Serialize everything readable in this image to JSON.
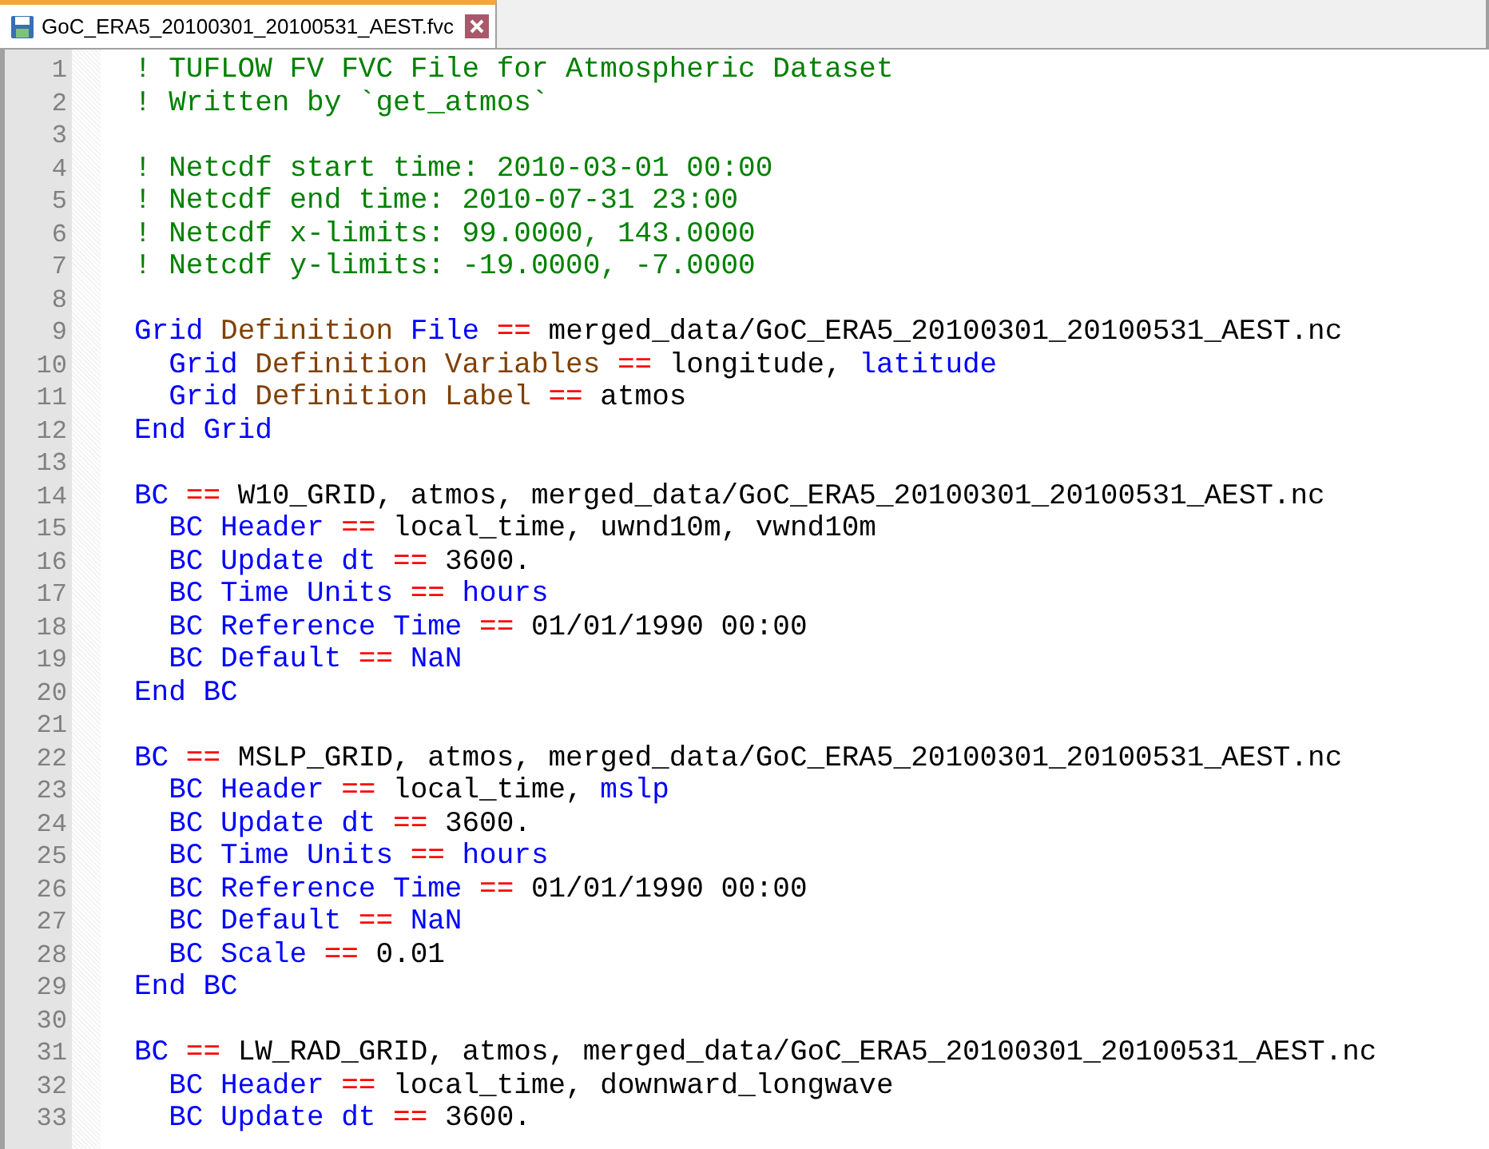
{
  "tab": {
    "title": "GoC_ERA5_20100301_20100531_AEST.fvc",
    "selected": true
  },
  "lines": [
    {
      "number": "1",
      "segments": [
        {
          "kind": "comment",
          "text": "! TUFLOW FV FVC File for Atmospheric Dataset"
        }
      ]
    },
    {
      "number": "2",
      "segments": [
        {
          "kind": "comment",
          "text": "! Written by `get_atmos`"
        }
      ]
    },
    {
      "number": "3"
    },
    {
      "number": "4",
      "segments": [
        {
          "kind": "comment",
          "text": "! Netcdf start time: 2010-03-01 00:00"
        }
      ]
    },
    {
      "number": "5",
      "segments": [
        {
          "kind": "comment",
          "text": "! Netcdf end time: 2010-07-31 23:00"
        }
      ]
    },
    {
      "number": "6",
      "segments": [
        {
          "kind": "comment",
          "text": "! Netcdf x-limits: 99.0000, 143.0000"
        }
      ]
    },
    {
      "number": "7",
      "segments": [
        {
          "kind": "comment",
          "text": "! Netcdf y-limits: -19.0000, -7.0000"
        }
      ]
    },
    {
      "number": "8"
    },
    {
      "number": "9",
      "segments": [
        {
          "kind": "keyword",
          "text": "Grid"
        },
        {
          "kind": "name",
          "text": " Definition"
        },
        {
          "kind": "keyword",
          "text": " File"
        },
        {
          "kind": "operator",
          "text": " =="
        },
        {
          "kind": "value",
          "text": " merged_data/GoC_ERA5_20100301_20100531_AEST.nc"
        }
      ]
    },
    {
      "number": "10",
      "segments": [
        {
          "kind": "keyword",
          "text": "  Grid"
        },
        {
          "kind": "name",
          "text": " Definition Variables"
        },
        {
          "kind": "operator",
          "text": " =="
        },
        {
          "kind": "value",
          "text": " longitude, "
        },
        {
          "kind": "keyword",
          "text": "latitude"
        }
      ]
    },
    {
      "number": "11",
      "segments": [
        {
          "kind": "keyword",
          "text": "  Grid"
        },
        {
          "kind": "name",
          "text": " Definition Label"
        },
        {
          "kind": "operator",
          "text": " =="
        },
        {
          "kind": "value",
          "text": " atmos"
        }
      ]
    },
    {
      "number": "12",
      "segments": [
        {
          "kind": "keyword",
          "text": "End Grid"
        }
      ]
    },
    {
      "number": "13"
    },
    {
      "number": "14",
      "segments": [
        {
          "kind": "keyword",
          "text": "BC"
        },
        {
          "kind": "operator",
          "text": " =="
        },
        {
          "kind": "value",
          "text": " W10_GRID, atmos, merged_data/GoC_ERA5_20100301_20100531_AEST.nc"
        }
      ]
    },
    {
      "number": "15",
      "segments": [
        {
          "kind": "keyword",
          "text": "  BC Header"
        },
        {
          "kind": "operator",
          "text": " =="
        },
        {
          "kind": "value",
          "text": " local_time, uwnd10m, vwnd10m"
        }
      ]
    },
    {
      "number": "16",
      "segments": [
        {
          "kind": "keyword",
          "text": "  BC Update dt"
        },
        {
          "kind": "operator",
          "text": " =="
        },
        {
          "kind": "value",
          "text": " 3600."
        }
      ]
    },
    {
      "number": "17",
      "segments": [
        {
          "kind": "keyword",
          "text": "  BC Time Units"
        },
        {
          "kind": "operator",
          "text": " =="
        },
        {
          "kind": "keyword",
          "text": " hours"
        }
      ]
    },
    {
      "number": "18",
      "segments": [
        {
          "kind": "keyword",
          "text": "  BC Reference Time"
        },
        {
          "kind": "operator",
          "text": " =="
        },
        {
          "kind": "value",
          "text": " 01/01/1990 00:00"
        }
      ]
    },
    {
      "number": "19",
      "segments": [
        {
          "kind": "keyword",
          "text": "  BC Default"
        },
        {
          "kind": "operator",
          "text": " =="
        },
        {
          "kind": "keyword",
          "text": " NaN"
        }
      ]
    },
    {
      "number": "20",
      "segments": [
        {
          "kind": "keyword",
          "text": "End BC"
        }
      ]
    },
    {
      "number": "21"
    },
    {
      "number": "22",
      "segments": [
        {
          "kind": "keyword",
          "text": "BC"
        },
        {
          "kind": "operator",
          "text": " =="
        },
        {
          "kind": "value",
          "text": " MSLP_GRID, atmos, merged_data/GoC_ERA5_20100301_20100531_AEST.nc"
        }
      ]
    },
    {
      "number": "23",
      "segments": [
        {
          "kind": "keyword",
          "text": "  BC Header"
        },
        {
          "kind": "operator",
          "text": " =="
        },
        {
          "kind": "value",
          "text": " local_time, "
        },
        {
          "kind": "keyword",
          "text": "mslp"
        }
      ]
    },
    {
      "number": "24",
      "segments": [
        {
          "kind": "keyword",
          "text": "  BC Update dt"
        },
        {
          "kind": "operator",
          "text": " =="
        },
        {
          "kind": "value",
          "text": " 3600."
        }
      ]
    },
    {
      "number": "25",
      "segments": [
        {
          "kind": "keyword",
          "text": "  BC Time Units"
        },
        {
          "kind": "operator",
          "text": " =="
        },
        {
          "kind": "keyword",
          "text": " hours"
        }
      ]
    },
    {
      "number": "26",
      "segments": [
        {
          "kind": "keyword",
          "text": "  BC Reference Time"
        },
        {
          "kind": "operator",
          "text": " =="
        },
        {
          "kind": "value",
          "text": " 01/01/1990 00:00"
        }
      ]
    },
    {
      "number": "27",
      "segments": [
        {
          "kind": "keyword",
          "text": "  BC Default"
        },
        {
          "kind": "operator",
          "text": " =="
        },
        {
          "kind": "keyword",
          "text": " NaN"
        }
      ]
    },
    {
      "number": "28",
      "segments": [
        {
          "kind": "keyword",
          "text": "  BC Scale"
        },
        {
          "kind": "operator",
          "text": " =="
        },
        {
          "kind": "value",
          "text": " 0.01"
        }
      ]
    },
    {
      "number": "29",
      "segments": [
        {
          "kind": "keyword",
          "text": "End BC"
        }
      ]
    },
    {
      "number": "30"
    },
    {
      "number": "31",
      "segments": [
        {
          "kind": "keyword",
          "text": "BC"
        },
        {
          "kind": "operator",
          "text": " =="
        },
        {
          "kind": "value",
          "text": " LW_RAD_GRID, atmos, merged_data/GoC_ERA5_20100301_20100531_AEST.nc"
        }
      ]
    },
    {
      "number": "32",
      "segments": [
        {
          "kind": "keyword",
          "text": "  BC Header"
        },
        {
          "kind": "operator",
          "text": " =="
        },
        {
          "kind": "value",
          "text": " local_time, downward_longwave"
        }
      ]
    },
    {
      "number": "33",
      "segments": [
        {
          "kind": "keyword",
          "text": "  BC Update dt"
        },
        {
          "kind": "operator",
          "text": " =="
        },
        {
          "kind": "value",
          "text": " 3600."
        }
      ]
    }
  ]
}
